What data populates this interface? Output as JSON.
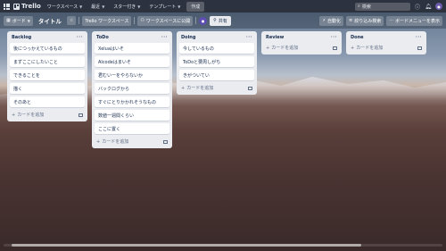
{
  "topbar": {
    "logo": "Trello",
    "workspaces": "ワークスペース",
    "recent": "最近",
    "starred": "スター付き",
    "templates": "テンプレート",
    "create": "作成",
    "search_placeholder": "検索"
  },
  "board": {
    "view_label": "ボード",
    "title": "タイトル",
    "workspace_visibility": "Trello ワークスペース",
    "visible_to_workspace": "ワークスペースに公開",
    "share": "共有",
    "automation": "自動化",
    "filter": "絞り込み検索",
    "show_menu": "ボードメニューを表示"
  },
  "lists": [
    {
      "title": "Backlog",
      "cards": [
        "後につっかえているもの",
        "まずここにしたいこと",
        "できることを",
        "描く",
        "そのあと"
      ],
      "add_label": "カードを追加"
    },
    {
      "title": "ToDo",
      "cards": [
        "Xeluaはいそ",
        "Alcodeはまいそ",
        "君むいーをやらないか",
        "バックログから",
        "すぐにとりかかれそうなもの",
        "数値一週間くらい",
        "ここに置く"
      ],
      "add_label": "カードを追加"
    },
    {
      "title": "Doing",
      "cards": [
        "今しているもの",
        "ToDoと要周しがち",
        "きがついてい"
      ],
      "add_label": "カードを追加"
    },
    {
      "title": "Review",
      "cards": [],
      "add_label": "カードを追加"
    },
    {
      "title": "Done",
      "cards": [],
      "add_label": "カードを追加"
    }
  ]
}
